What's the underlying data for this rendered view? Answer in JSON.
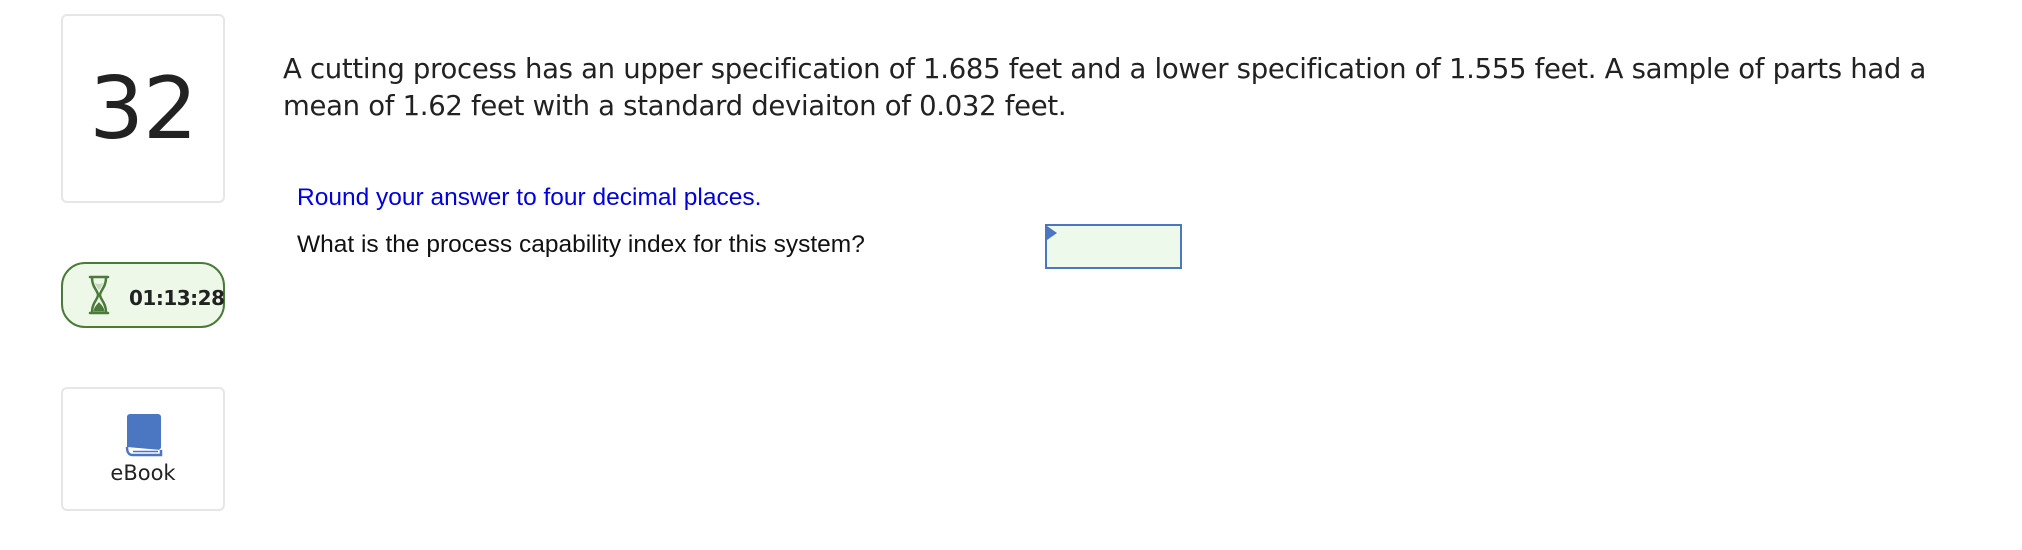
{
  "question_number": "32",
  "timer": {
    "icon": "hourglass-icon",
    "value": "01:13:28"
  },
  "ebook": {
    "icon": "book-icon",
    "label": "eBook"
  },
  "question": {
    "text": "A cutting process has an upper specification of 1.685 feet and a lower specification of 1.555 feet. A sample of parts had a mean of 1.62 feet with a standard deviaiton of 0.032 feet."
  },
  "instruction": "Round your answer to four decimal places.",
  "prompt": "What is the process capability index for this system?",
  "answer": {
    "value": "",
    "placeholder": ""
  },
  "colors": {
    "accent_green": "#4b7a3a",
    "timer_bg": "#edf8e8",
    "instruction_blue": "#0000dd",
    "input_border": "#4a76c2",
    "input_bg": "#edf9ea",
    "book_blue": "#4a76c2"
  }
}
